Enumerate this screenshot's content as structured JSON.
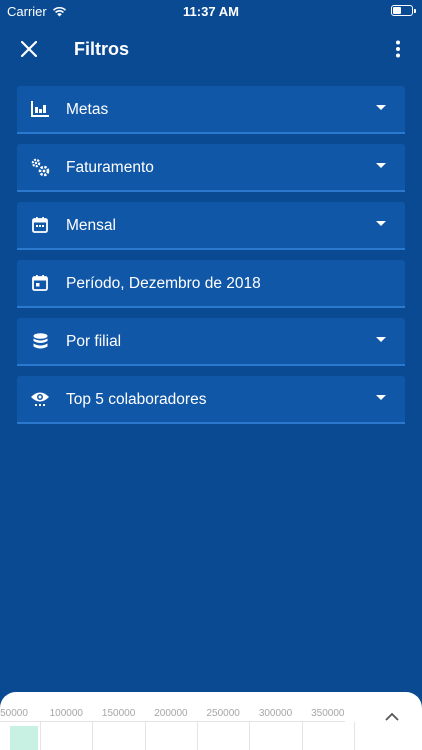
{
  "status": {
    "carrier": "Carrier",
    "time": "11:37 AM"
  },
  "header": {
    "title": "Filtros"
  },
  "filters": [
    {
      "icon": "bar-chart-icon",
      "label": "Metas",
      "dropdown": true
    },
    {
      "icon": "gears-icon",
      "label": "Faturamento",
      "dropdown": true
    },
    {
      "icon": "calendar-icon",
      "label": "Mensal",
      "dropdown": true
    },
    {
      "icon": "calendar-event-icon",
      "label": "Período,  Dezembro de 2018",
      "dropdown": false
    },
    {
      "icon": "database-icon",
      "label": "Por filial",
      "dropdown": true
    },
    {
      "icon": "eye-icon",
      "label": "Top 5 colaboradores",
      "dropdown": true
    }
  ],
  "chart_data": {
    "type": "bar",
    "x_ticks": [
      "50000",
      "100000",
      "150000",
      "200000",
      "250000",
      "300000",
      "350000"
    ],
    "series": [],
    "colors": {
      "bar": "#c8f0e3"
    }
  }
}
